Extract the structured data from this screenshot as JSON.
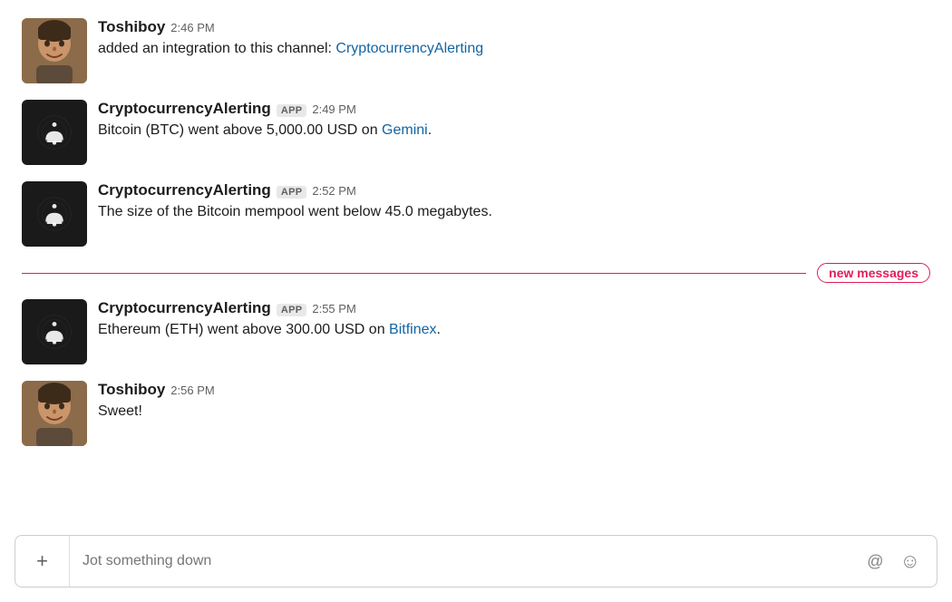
{
  "messages": [
    {
      "id": "msg1",
      "type": "human",
      "sender": "Toshiboy",
      "timestamp": "2:46 PM",
      "isApp": false,
      "text_plain": "added an integration to this channel: ",
      "link_text": "CryptocurrencyAlerting",
      "link_url": "#"
    },
    {
      "id": "msg2",
      "type": "bot",
      "sender": "CryptocurrencyAlerting",
      "timestamp": "2:49 PM",
      "isApp": true,
      "text_plain": "Bitcoin (BTC) went above 5,000.00 USD on ",
      "link_text": "Gemini",
      "link_url": "#",
      "text_suffix": "."
    },
    {
      "id": "msg3",
      "type": "bot",
      "sender": "CryptocurrencyAlerting",
      "timestamp": "2:52 PM",
      "isApp": true,
      "text_plain": "The size of the Bitcoin mempool went below 45.0 megabytes.",
      "link_text": null,
      "link_url": null
    },
    {
      "id": "msg4",
      "type": "bot",
      "sender": "CryptocurrencyAlerting",
      "timestamp": "2:55 PM",
      "isApp": true,
      "text_plain": "Ethereum (ETH) went above 300.00 USD on ",
      "link_text": "Bitfinex",
      "link_url": "#",
      "text_suffix": "."
    },
    {
      "id": "msg5",
      "type": "human",
      "sender": "Toshiboy",
      "timestamp": "2:56 PM",
      "isApp": false,
      "text_plain": "Sweet!",
      "link_text": null,
      "link_url": null
    }
  ],
  "new_messages_label": "new messages",
  "new_messages_after_index": 2,
  "input": {
    "placeholder": "Jot something down",
    "plus_label": "+",
    "at_symbol": "@",
    "emoji_symbol": "☺"
  },
  "colors": {
    "accent": "#1264a3",
    "new_messages": "#e01e5a",
    "bot_bg": "#1a1a1a"
  }
}
